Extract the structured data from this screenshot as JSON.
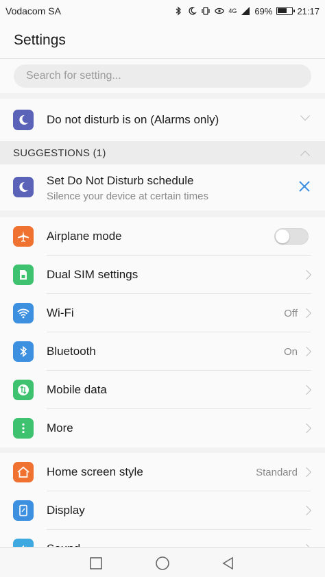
{
  "status": {
    "carrier": "Vodacom SA",
    "battery": "69%",
    "time": "21:17",
    "signal_label": "4G",
    "battery_level": 0.69
  },
  "header": {
    "title": "Settings"
  },
  "search": {
    "placeholder": "Search for setting..."
  },
  "dnd": {
    "label": "Do not disturb is on (Alarms only)"
  },
  "suggestions": {
    "heading": "SUGGESTIONS (1)",
    "item": {
      "title": "Set Do Not Disturb schedule",
      "subtitle": "Silence your device at certain times"
    }
  },
  "group1": [
    {
      "label": "Airplane mode",
      "icon": "airplane-icon",
      "color": "#f07230",
      "control": "toggle",
      "on": false
    },
    {
      "label": "Dual SIM settings",
      "icon": "sim-icon",
      "color": "#3fc270"
    },
    {
      "label": "Wi-Fi",
      "icon": "wifi-icon",
      "color": "#3d8fe0",
      "value": "Off"
    },
    {
      "label": "Bluetooth",
      "icon": "bluetooth-icon",
      "color": "#3d8fe0",
      "value": "On"
    },
    {
      "label": "Mobile data",
      "icon": "mobile-data-icon",
      "color": "#3fc270"
    },
    {
      "label": "More",
      "icon": "more-icon",
      "color": "#3fc270"
    }
  ],
  "group2": [
    {
      "label": "Home screen style",
      "icon": "home-icon",
      "color": "#f07230",
      "value": "Standard"
    },
    {
      "label": "Display",
      "icon": "display-icon",
      "color": "#3d8fe0"
    },
    {
      "label": "Sound",
      "icon": "sound-icon",
      "color": "#3da9e0"
    }
  ],
  "colors": {
    "moon": "#5b63b8",
    "accent": "#3d8fe0"
  }
}
